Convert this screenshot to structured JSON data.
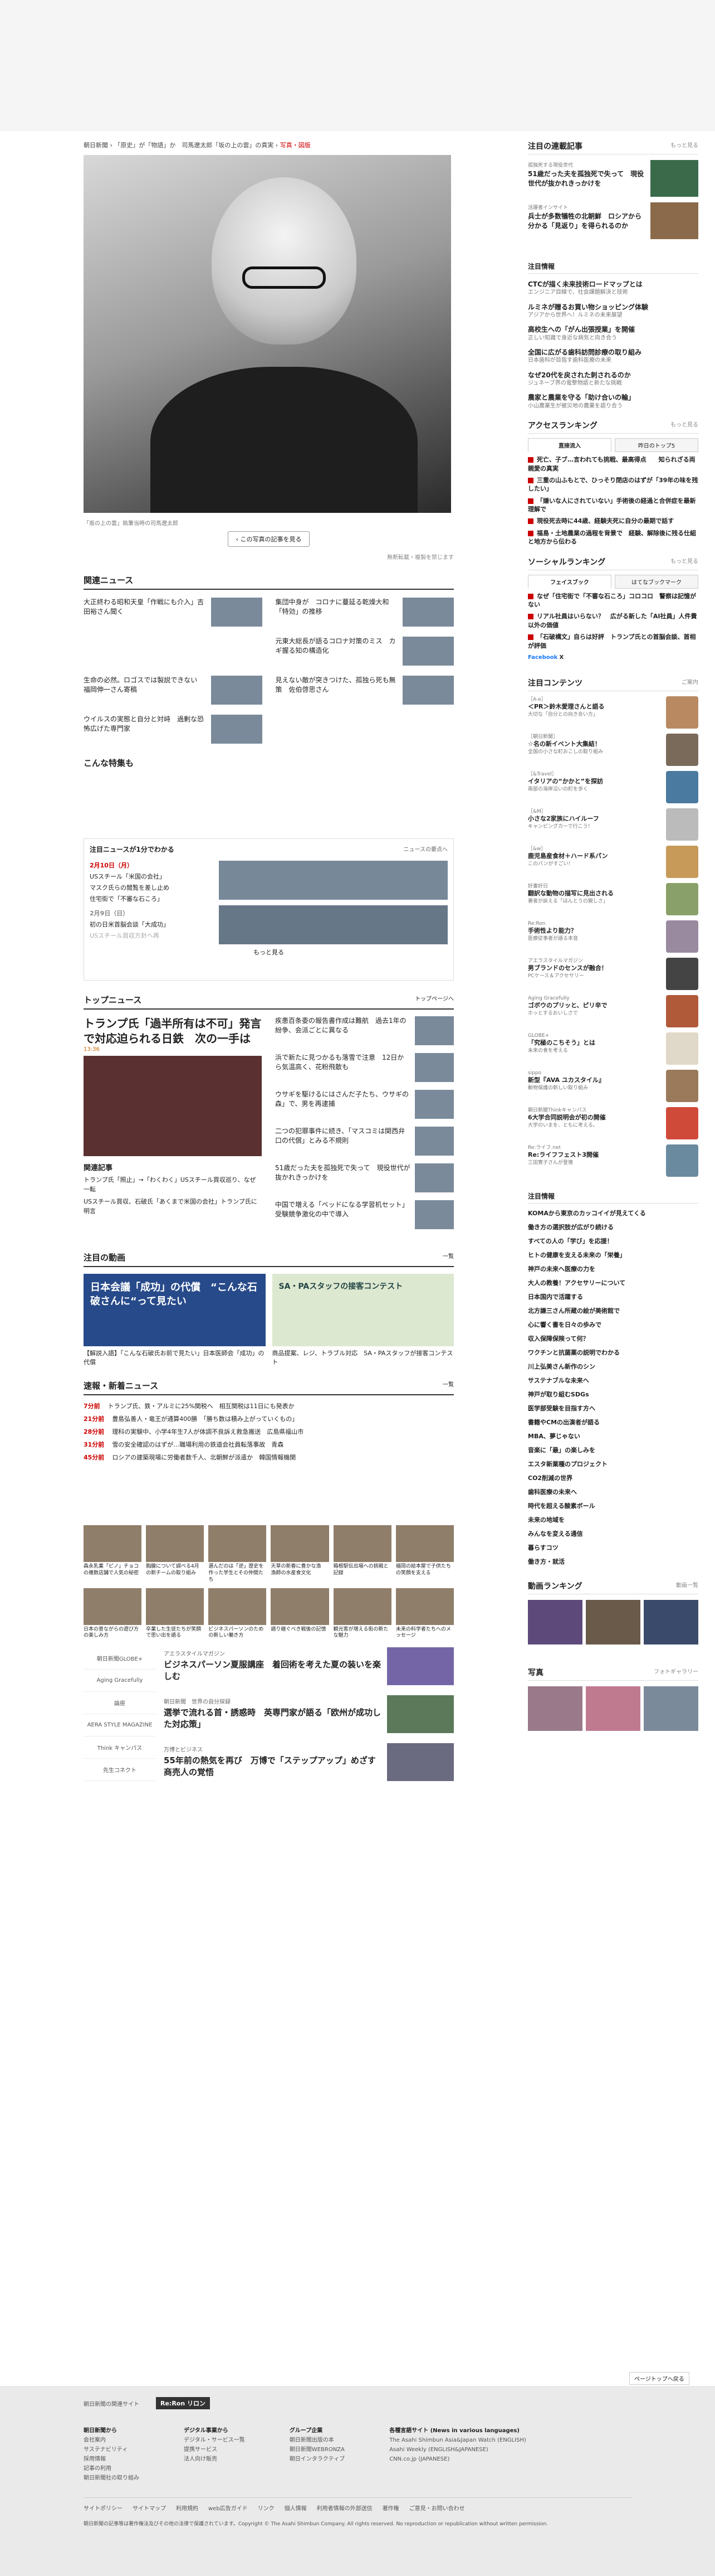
{
  "breadcrumb": {
    "parts": [
      "朝日新聞",
      "「原史」が「物語」か　司馬遼太郎「坂の上の雲」の真実"
    ],
    "current": "写真・図版"
  },
  "photo": {
    "caption": "「坂の上の雲」執筆当時の司馬遼太郎",
    "button": "この写真の記事を見る",
    "note": "無断転載・複製を禁じます"
  },
  "related": {
    "title": "関連ニュース",
    "items": [
      "大正終わる昭和天皇「作戦にも介入」吉田裕さん聞く",
      "集団中身が　コロナに蔓延る乾燥大和「特効」の推移",
      "元東大総長が語るコロナ対策のミス　カギ握る知の構造化",
      "生命の必然。ロゴスでは製説できない　福岡伸一さん寄稿",
      "見えない敵が突きつけた、孤独ら死も無策　佐伯啓思さん",
      "ウイルスの実態と自分と対峙　過剰な恐怖広げた専門家"
    ],
    "special": "こんな特集も"
  },
  "summary": {
    "title": "注目ニュースが1分でわかる",
    "more": "ニュースの要点へ",
    "date1": "2月10日（月）",
    "items1": [
      "USスチール「米国の会社」",
      "マスク氏らの閲覧を差し止め",
      "住宅街で「不審な石ころ」"
    ],
    "date2": "2月9日（日）",
    "items2": [
      "初の日米首脳会談「大成功」",
      "USスチール買収方針へ再"
    ],
    "more_btn": "もっと見る"
  },
  "topnews": {
    "title": "トップニュース",
    "more": "トップページへ",
    "main": "トランプ氏「過半所有は不可」発言で対応迫られる日鉄　次の一手は",
    "main_time": "13:36",
    "list": [
      "疾患百条委の報告書作成は難航　過去1年の紛争、会派ごとに異なる",
      "浜で新たに見つかるも落雪で注意　12日から気温高く、花粉飛散も",
      "ウサギを駆けるにはさんだ子たち、ウサギの森」で、男を再逮捕",
      "二つの犯罪事件に続き、「マスコミは関西弁口の代償」とみる不規則",
      "51歳だった夫を孤独死で失って　現役世代が抜かれきっかけを",
      "中国で増える「ベッドになる学習机セット」受験競争激化の中で導入"
    ],
    "related_title": "関連記事",
    "related": [
      "トランプ氏「照止」→「わくわく」USスチール買収巡り、なぜ一転",
      "USスチール買収、石破氏「あくまで米国の会社」トランプ氏に明言"
    ]
  },
  "video": {
    "title": "注目の動画",
    "more": "一覧",
    "v1": "日本会議「成功」の代償　“こんな石破さんに“って見たい",
    "v1cap": "【解説入語】「こんな石破氏お前で見たい」日本医師会「成功」の代償",
    "v2": "SA・PAスタッフの接客コンテスト",
    "v2cap": "商品提案、レジ、トラブル対応　SA・PAスタッフが接客コンテスト"
  },
  "breaking": {
    "title": "速報・新着ニュース",
    "more": "一覧",
    "items": [
      {
        "t": "7分前",
        "s": "トランプ氏、鉄・アルミに25%関税へ　相互関税は11日にも発表か"
      },
      {
        "t": "21分前",
        "s": "豊島弘善人・竜王が通算400勝　「勝ち数は積み上がっていくもの」"
      },
      {
        "t": "28分前",
        "s": "理科の実験中、小学4年生7人が体調不良訴え救急搬送　広島県福山市"
      },
      {
        "t": "31分前",
        "s": "雪の安全確認のはずが…職場利用の鉄道会社員転落事故　青森"
      },
      {
        "t": "45分前",
        "s": "ロシアの建築現場に労働者数千人、北朝鮮が派遣か　韓国情報機関"
      }
    ]
  },
  "gallery": [
    "森永乳業「ピノ」チョコの複数店舗で人気の秘密",
    "胸腺について調べる4月の新チームの取り組み",
    "選んだのは「逆」歴史を作った学生とその仲間たち",
    "天草の新春に豊かな漁　漁師の水産食文化",
    "箱根駅伝出場への挑戦と記録",
    "福岡の絵本屋で子供たちの笑顔を支える",
    "日本の昔ながらの遊び方の楽しみ方",
    "卒業した生徒たちが笑顔で思い出を語る",
    "ビジネスパーソンのための新しい働き方",
    "語り継ぐべき戦後の記憶",
    "観光客が増える街の新たな魅力",
    "未来の科学者たちへのメッセージ"
  ],
  "logos": [
    "朝日新聞GLOBE+",
    "Aging Gracefully",
    "論座",
    "AERA STYLE MAGAZINE",
    "Think キャンパス",
    "先生コネクト"
  ],
  "features": [
    {
      "cat": "アエラスタイルマガジン",
      "t": "ビジネスパーソン夏服講座　着回術を考えた夏の装いを楽しむ"
    },
    {
      "cat": "朝日新聞　世界の自分探録",
      "t": "選挙で流れる首・誘惑時　英専門家が語る「欧州が成功した対応策」"
    },
    {
      "cat": "万博とビジネス",
      "t": "55年前の熱気を再び　万博で「ステップアップ」めざす商売人の覚悟"
    }
  ],
  "side": {
    "featured": {
      "title": "注目の連載記事",
      "more": "もっと見る",
      "items": [
        {
          "cat": "孤独死する現役世代",
          "t": "51歳だった夫を孤独死で失って　現役世代が抜かれきっかけを"
        },
        {
          "cat": "活躍者インサイト",
          "t": "兵士が多数犠牲の北朝鮮　ロシアから分かる「見返り」を得られるのか"
        }
      ]
    },
    "ad": {
      "title": "注目情報",
      "items": [
        {
          "t": "CTCが描く未来技術ロードマップとは",
          "s": "エンジニア目線で、社会課題解決と技術"
        },
        {
          "t": "ルミネが贈るお買い物ショッピング体験",
          "s": "アジアから世界へ！ルミネの未来展望"
        },
        {
          "t": "高校生への「がん出張授業」を開催",
          "s": "正しい知識で身近な病気と向き合う"
        },
        {
          "t": "全国に広がる歯科訪問診療の取り組み",
          "s": "日本歯科が目指す歯科医療の未来"
        },
        {
          "t": "なぜ20代を戻された刺されるのか",
          "s": "ジュネーブ界の電撃物語と新たな挑戦"
        },
        {
          "t": "農家と農業を守る「助け合いの輪」",
          "s": "小山農業生が被災地の農業を語り合う"
        }
      ]
    },
    "access": {
      "title": "アクセスランキング",
      "more": "もっと見る",
      "tabs": [
        "直接流入",
        "昨日のトップ5"
      ],
      "items": [
        "死亡、子ブ…言われても挑戦、最高得点　　知られざる両親愛の真実",
        "三重の山ふもとで、ひっそり閉店のはずが「39年の味を残したい」",
        "「嫌いな人にされていない」手術後の経過と合併症を最新理解で",
        "現役死去時に44歳、経験夫死に自分の最期で話す",
        "福島・土地農業の過程を背景で　経験、解除後に残る仕組と地方から伝わる"
      ]
    },
    "social": {
      "title": "ソーシャルランキング",
      "more": "もっと見る",
      "tabs": [
        "フェイスブック",
        "はてなブックマーク"
      ],
      "items": [
        "なぜ「住宅街で「不審な石ころ」コロコロ　警察は記憶がない",
        "リアル社員はいらない？　広がる新した「AI社員」人件費以外の価値",
        "「石破構文」自らは好評　トランプ氏との首脳会談、首相が評価"
      ],
      "fb": "Facebook",
      "x": "X"
    },
    "content": {
      "title": "注目コンテンツ",
      "more": "ご案内",
      "items": [
        {
          "c": "［A-e］",
          "t": "＜PR＞鈴木愛理さんと語る",
          "s": "大切な「自分との向き合い方」"
        },
        {
          "c": "［朝日新聞］",
          "t": "☆名の新イベント大集結！",
          "s": "全国の小さな町おこしの取り組み"
        },
        {
          "c": "［&Travel］",
          "t": "イタリアの“かかと”を探訪",
          "s": "南部の海岸沿いの町を歩く"
        },
        {
          "c": "［&M］",
          "t": "小さな2家族にハイルーフ",
          "s": "キャンピングカーで行こう！"
        },
        {
          "c": "［&w］",
          "t": "鹿児島産食材＋ハード系パン",
          "s": "このパンがすごい！"
        },
        {
          "c": "好書好日",
          "t": "翻訳な動物の描写に見出される",
          "s": "著者が訴える「ほんとうの親しさ」"
        },
        {
          "c": "Re:Ron",
          "t": "手術性より能力？",
          "s": "医療従事者が語る本音"
        },
        {
          "c": "アエラスタイルマガジン",
          "t": "男ブランドのセンスが融合！",
          "s": "PCケース＆アクセサリー"
        },
        {
          "c": "Aging Gracefully",
          "t": "ゴボウのプリッと、ピリ辛で",
          "s": "ホッとするおいしさで"
        },
        {
          "c": "GLOBE+",
          "t": "「究極のこちそう」とは",
          "s": "未来の食を考える"
        },
        {
          "c": "sippo",
          "t": "新型『AVA ユカスタイル』",
          "s": "動物保護の新しい取り組み"
        },
        {
          "c": "朝日新聞Thinkキャンパス",
          "t": "6大学合同説明会が初の開催",
          "s": "大学のいまを、ともに考える。"
        },
        {
          "c": "Re:ライフ.net",
          "t": "Re:ライフフェスト3開催",
          "s": "三田寛子さんが登壇"
        }
      ]
    },
    "plain": {
      "title": "注目情報",
      "items": [
        "KOMAから東京のカッコイイが見えてくる",
        "働き方の選択肢が広がり続ける",
        "すべての人の「学び」を応援！",
        "ヒトの健康を支える未来の「栄養」",
        "神戸の未来へ医療の力を",
        "大人の教養！アクセサリーについて",
        "日本国内で活躍する",
        "北方謙三さん所蔵の絵が美術館で",
        "心に響く書を日々の歩みで",
        "収入保障保険って何？",
        "ワクチンと抗菌薬の説明でわかる",
        "川上弘美さん新作のシン",
        "サステナブルな未来へ",
        "神戸が取り組むSDGs",
        "医学部受験を目指す方へ",
        "書籍やCMの出演者が語る",
        "MBA、夢じゃない",
        "音楽に「最」の楽しみを",
        "エスタ新業種のプロジェクト",
        "CO2削減の世界",
        "歯科医療の未来へ",
        "時代を超える酸素ボール",
        "未来の地域を",
        "みんなを変える通信",
        "暮らすコツ",
        "働き方・就活"
      ]
    },
    "videoRank": {
      "title": "動画ランキング",
      "more": "動画一覧"
    },
    "photoSec": {
      "title": "写真",
      "more": "フォトギャラリー"
    }
  },
  "footer": {
    "sitesLabel": "朝日新聞の関連サイト",
    "reron": "Re:Ron リロン",
    "backToTop": "ページトップへ戻る",
    "cols": [
      {
        "h": "朝日新聞から",
        "l": [
          "会社案内",
          "サステナビリティ",
          "採用情報",
          "記事の利用",
          "朝日新聞社の取り組み"
        ]
      },
      {
        "h": "デジタル事業から",
        "l": [
          "デジタル・サービス一覧",
          "提携サービス",
          "法人向け販売"
        ]
      },
      {
        "h": "グループ企業",
        "l": [
          "朝日新聞出版の本",
          "朝日新聞WEBRONZA",
          "朝日インタラクティブ"
        ]
      },
      {
        "h": "各種言語サイト (News in various languages)",
        "l": [
          "The Asahi Shimbun Asia&Japan Watch (ENGLISH)",
          "Asahi Weekly (ENGLISH&JAPANESE)",
          "CNN.co.jp (JAPANESE)"
        ]
      }
    ],
    "links": [
      "サイトポリシー",
      "サイトマップ",
      "利用規約",
      "web広告ガイド",
      "リンク",
      "個人情報",
      "利用者情報の外部送信",
      "著作権",
      "ご意見・お問い合わせ"
    ],
    "copyright": "朝日新聞の記事等は著作権法及びその他の法律で保護されています。Copyright © The Asahi Shimbun Company. All rights reserved. No reproduction or republication without written permission."
  }
}
